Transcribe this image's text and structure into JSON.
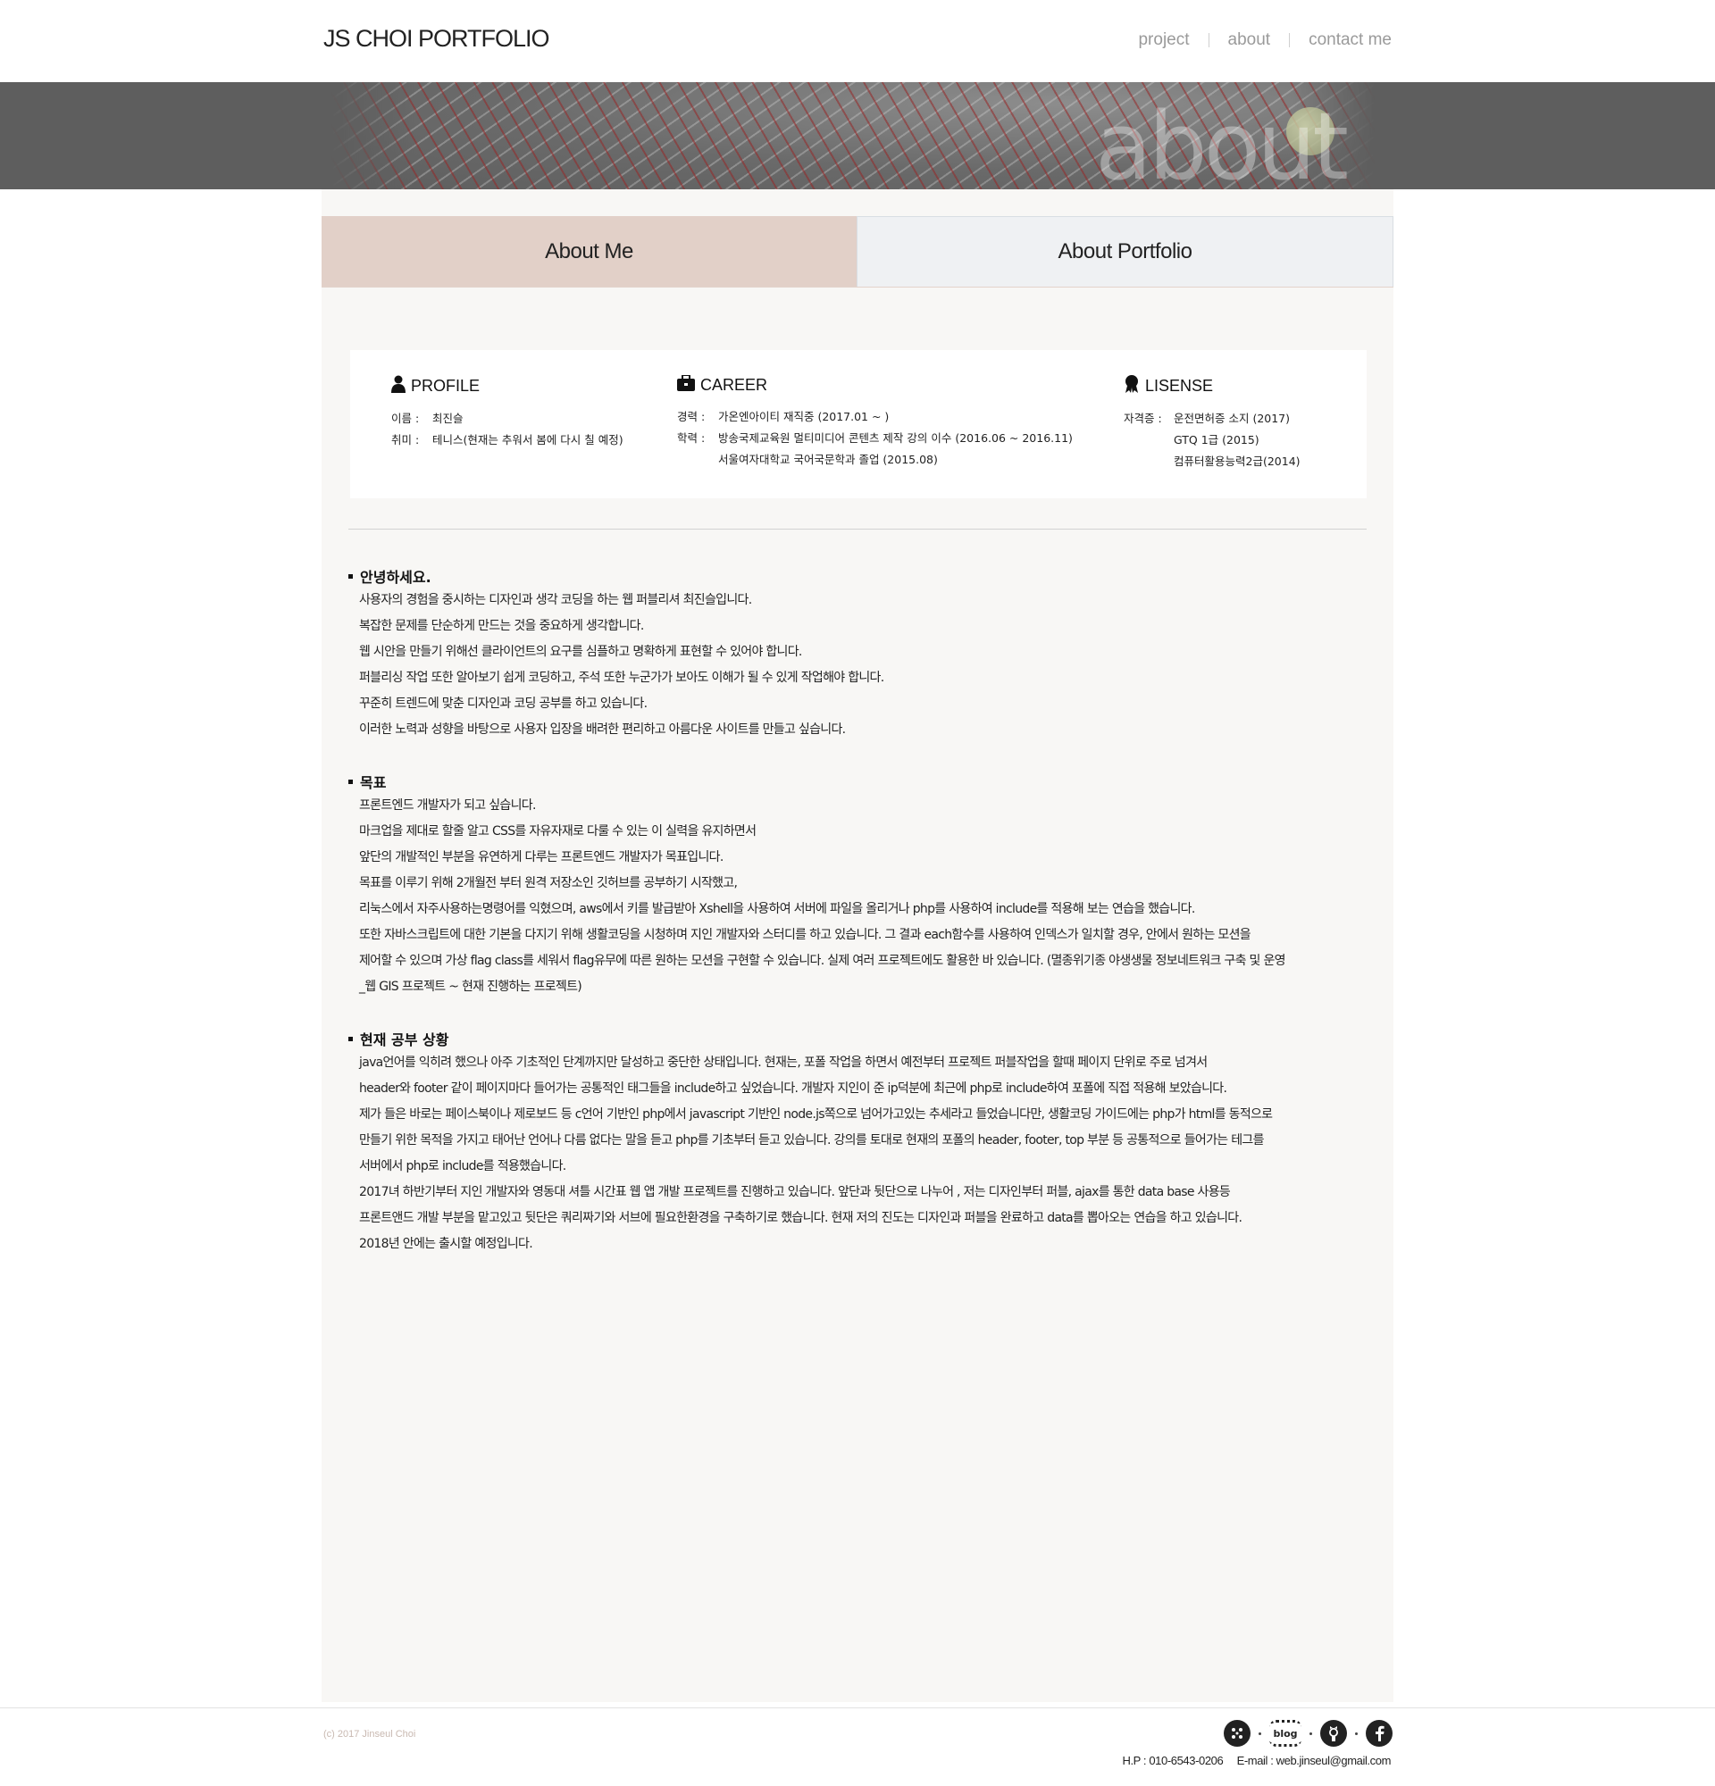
{
  "header": {
    "logo": "JS CHOI PORTFOLIO",
    "nav": [
      {
        "label": "project"
      },
      {
        "label": "about"
      },
      {
        "label": "contact me"
      }
    ]
  },
  "banner": {
    "word": "about"
  },
  "tabs": [
    {
      "label": "About Me",
      "active": true
    },
    {
      "label": "About Portfolio",
      "active": false
    }
  ],
  "profile": {
    "heading": "PROFILE",
    "icon": "person-icon",
    "rows": [
      {
        "key": "이름 :",
        "value": "최진슬"
      },
      {
        "key": "취미 :",
        "value": "테니스(현재는 추워서 봄에 다시 칠 예정)"
      }
    ]
  },
  "career": {
    "heading": "CAREER",
    "icon": "briefcase-icon",
    "rows": [
      {
        "key": "경력 :",
        "value": "가온엔아이티 재직중 (2017.01 ~ )"
      },
      {
        "key": "학력 :",
        "value": "방송국제교육원 멀티미디어 콘텐츠 제작 강의 이수 (2016.06 ~ 2016.11)"
      },
      {
        "key": "",
        "value": "서울여자대학교 국어국문학과 졸업 (2015.08)"
      }
    ]
  },
  "license": {
    "heading": "LISENSE",
    "icon": "award-ribbon-icon",
    "rows": [
      {
        "key": "자격증 :",
        "value": "운전면허증 소지 (2017)"
      },
      {
        "key": "",
        "value": "GTQ 1급 (2015)"
      },
      {
        "key": "",
        "value": "컴퓨터활용능력2급(2014)"
      }
    ]
  },
  "sections": [
    {
      "title": "안녕하세요.",
      "lines": [
        "사용자의 경험을 중시하는 디자인과 생각 코딩을 하는 웹 퍼블리셔 최진슬입니다.",
        "복잡한 문제를 단순하게 만드는 것을 중요하게 생각합니다.",
        "웹 시안을 만들기 위해선 클라이언트의 요구를 심플하고 명확하게 표현할 수 있어야 합니다.",
        "퍼블리싱 작업 또한 알아보기 쉽게 코딩하고, 주석 또한 누군가가 보아도 이해가 될 수 있게 작업해야 합니다.",
        "꾸준히 트렌드에 맞춘 디자인과 코딩 공부를 하고 있습니다.",
        "이러한 노력과 성향을 바탕으로 사용자 입장을 배려한 편리하고 아름다운 사이트를 만들고 싶습니다."
      ]
    },
    {
      "title": "목표",
      "lines": [
        "프론트엔드 개발자가 되고 싶습니다.",
        "마크업을 제대로 할줄 알고 CSS를 자유자재로 다룰 수 있는 이 실력을 유지하면서",
        "앞단의 개발적인 부분을 유연하게 다루는 프론트엔드 개발자가 목표입니다.",
        "목표를 이루기 위해 2개월전 부터 원격 저장소인 깃허브를 공부하기 시작했고,",
        "리눅스에서 자주사용하는명령어를 익혔으며, aws에서 키를 발급받아 Xshell을 사용하여 서버에 파일을 올리거나 php를 사용하여 include를 적용해 보는 연습을 했습니다.",
        "또한 자바스크립트에 대한 기본을 다지기 위해 생활코딩을 시청하며 지인 개발자와 스터디를 하고 있습니다.  그 결과 each함수를 사용하여 인덱스가 일치할 경우, 안에서  원하는 모션을",
        "제어할 수 있으며 가상 flag class를 세워서 flag유무에 따른 원하는 모션을 구현할 수 있습니다. 실제 여러 프로젝트에도 활용한 바 있습니다. (멸종위기종 야생생물 정보네트워크 구축 및 운영",
        "_웹 GIS 프로젝트 ~ 현재 진행하는 프로젝트)"
      ]
    },
    {
      "title": "현재 공부 상황",
      "lines": [
        "java언어를 익히려 했으나 아주 기초적인 단계까지만 달성하고 중단한 상태입니다. 현재는, 포폴 작업을 하면서 예전부터 프로젝트 퍼블작업을 할때 페이지 단위로 주로 넘겨서",
        "header와 footer 같이 페이지마다 들어가는 공통적인 태그들을 include하고 싶었습니다. 개발자 지인이 준 ip덕분에 최근에 php로 include하여 포폴에 직접 적용해 보았습니다.",
        "제가 들은 바로는 페이스북이나 제로보드 등 c언어 기반인 php에서 javascript 기반인 node.js쪽으로 넘어가고있는 추세라고 들었습니다만, 생활코딩 가이드에는 php가  html를 동적으로",
        "만들기 위한 목적을 가지고 태어난 언어나 다름 없다는 말을 듣고 php를 기초부터 듣고 있습니다.  강의를 토대로 현재의 포폴의 header, footer, top 부분 등  공통적으로 들어가는 테그를",
        "서버에서 php로 include를 적용했습니다.",
        "2017녀 하반기부터  지인 개발자와 영동대 셔틀 시간표 웹 앱 개발 프로젝트를 진행하고 있습니다. 앞단과 뒷단으로 나누어 , 저는 디자인부터 퍼블, ajax를 통한 data base 사용등",
        "프론트앤드 개발 부분을 맡고있고  뒷단은 쿼리짜기와 서브에 필요한환경을 구축하기로 했습니다. 현재 저의 진도는 디자인과 퍼블을 완료하고 data를 뽑아오는 연습을 하고 있습니다.",
        "2018년 안에는 출시할 예정입니다."
      ]
    }
  ],
  "footer": {
    "copyright": "(c) 2017 Jinseul Choi",
    "social": [
      {
        "name": "dots-icon"
      },
      {
        "name": "blog-icon",
        "label": "blog"
      },
      {
        "name": "github-icon"
      },
      {
        "name": "facebook-icon"
      }
    ],
    "phone": "H.P : 010-6543-0206",
    "email": "E-mail : web.jinseul@gmail.com"
  },
  "colors": {
    "active_tab": "#e2d0c8",
    "inactive_tab": "#eff1f3",
    "panel_bg": "#f8f7f5",
    "banner_bg": "#5e5e5e"
  }
}
